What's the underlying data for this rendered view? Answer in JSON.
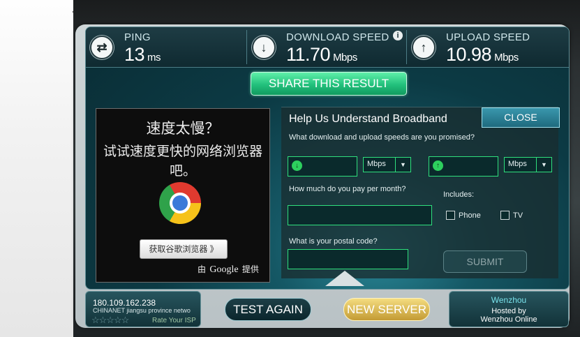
{
  "stats": {
    "ping": {
      "label": "PING",
      "value": "13",
      "unit": "ms"
    },
    "download": {
      "label": "DOWNLOAD SPEED",
      "value": "11.70",
      "unit": "Mbps",
      "info": "i"
    },
    "upload": {
      "label": "UPLOAD SPEED",
      "value": "10.98",
      "unit": "Mbps"
    }
  },
  "share_label": "SHARE THIS RESULT",
  "ad": {
    "line1": "速度太慢？",
    "line2": "试试速度更快的网络浏览器吧。",
    "download_label": "获取谷歌浏览器 》",
    "by_prefix": "由",
    "by_brand": "Google",
    "by_suffix": "提供"
  },
  "survey": {
    "title": "Help Us Understand Broadband",
    "close_label": "CLOSE",
    "q_speeds": "What download and upload speeds are you promised?",
    "download_unit": "Mbps",
    "upload_unit": "Mbps",
    "q_pay": "How much do you pay per month?",
    "includes_label": "Includes:",
    "phone_label": "Phone",
    "tv_label": "TV",
    "q_postal": "What is your postal code?",
    "submit_label": "SUBMIT"
  },
  "bottom": {
    "ip": "180.109.162.238",
    "isp": "CHINANET jiangsu province netwo",
    "stars": "☆☆☆☆☆",
    "rate_label": "Rate Your ISP",
    "test_again_label": "TEST AGAIN",
    "new_server_label": "NEW SERVER",
    "server_city": "Wenzhou",
    "hosted_by_line1": "Hosted by",
    "hosted_by_line2": "Wenzhou Online"
  },
  "colors": {
    "accent_green": "#22c07c",
    "field_border": "#2fe07d",
    "gold": "#c39b34"
  }
}
